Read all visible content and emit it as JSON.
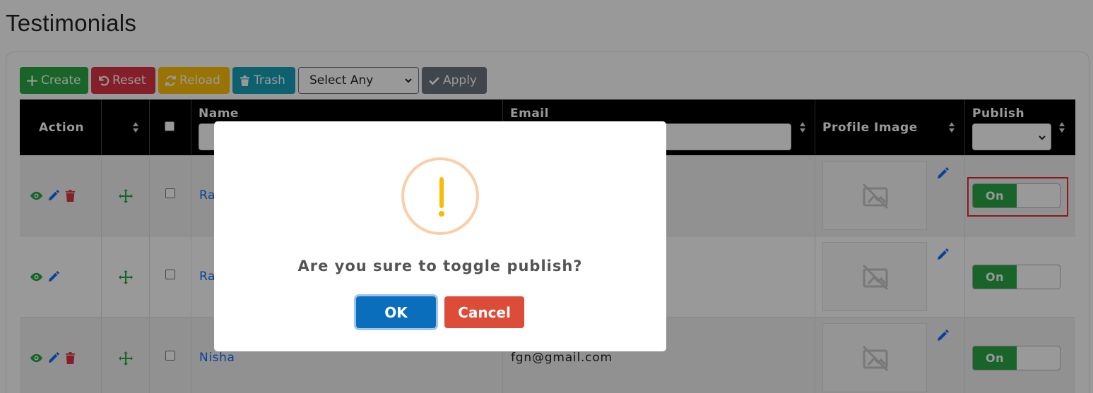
{
  "page": {
    "title": "Testimonials"
  },
  "toolbar": {
    "create_label": "Create",
    "reset_label": "Reset",
    "reload_label": "Reload",
    "trash_label": "Trash",
    "select_value": "Select Any",
    "apply_label": "Apply"
  },
  "table": {
    "headers": {
      "action": "Action",
      "name": "Name",
      "email": "Email",
      "profile_image": "Profile Image",
      "publish": "Publish"
    },
    "rows": [
      {
        "name": "Ra",
        "email": "",
        "publish": "On",
        "has_delete": true
      },
      {
        "name": "Ra",
        "email": "",
        "publish": "On",
        "has_delete": false
      },
      {
        "name": "Nisha",
        "email": "fgn@gmail.com",
        "publish": "On",
        "has_delete": true
      }
    ]
  },
  "dialog": {
    "icon": "warning-icon",
    "message": "Are you sure to toggle publish?",
    "ok_label": "OK",
    "cancel_label": "Cancel"
  },
  "colors": {
    "create": "#28a745",
    "reset": "#dc3545",
    "reload": "#ffc107",
    "trash": "#17a2b8",
    "apply": "#6c757d",
    "ok": "#0a6ebd",
    "cancel": "#dd4b39",
    "highlight": "#e8282f"
  }
}
